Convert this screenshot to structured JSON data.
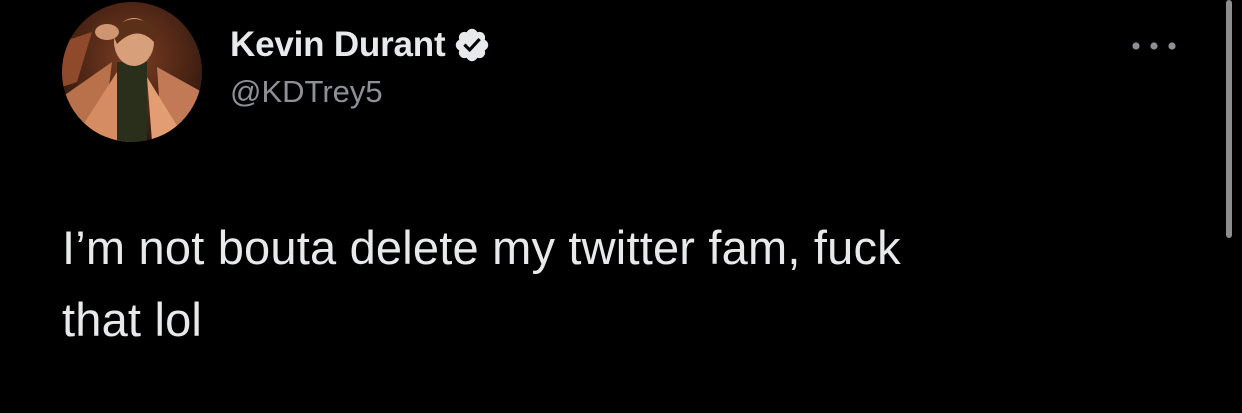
{
  "author": {
    "display_name": "Kevin Durant",
    "handle": "@KDTrey5",
    "verified": true,
    "verified_icon": "verified-badge-icon"
  },
  "tweet": {
    "text": "I’m not bouta delete my twitter fam, fuck\nthat lol"
  },
  "menu": {
    "icon": "more-horizontal-icon"
  },
  "colors": {
    "background": "#000000",
    "primary_text": "#e7e9ea",
    "secondary_text": "#8b9196",
    "scrollbar": "#8e8e8e"
  }
}
